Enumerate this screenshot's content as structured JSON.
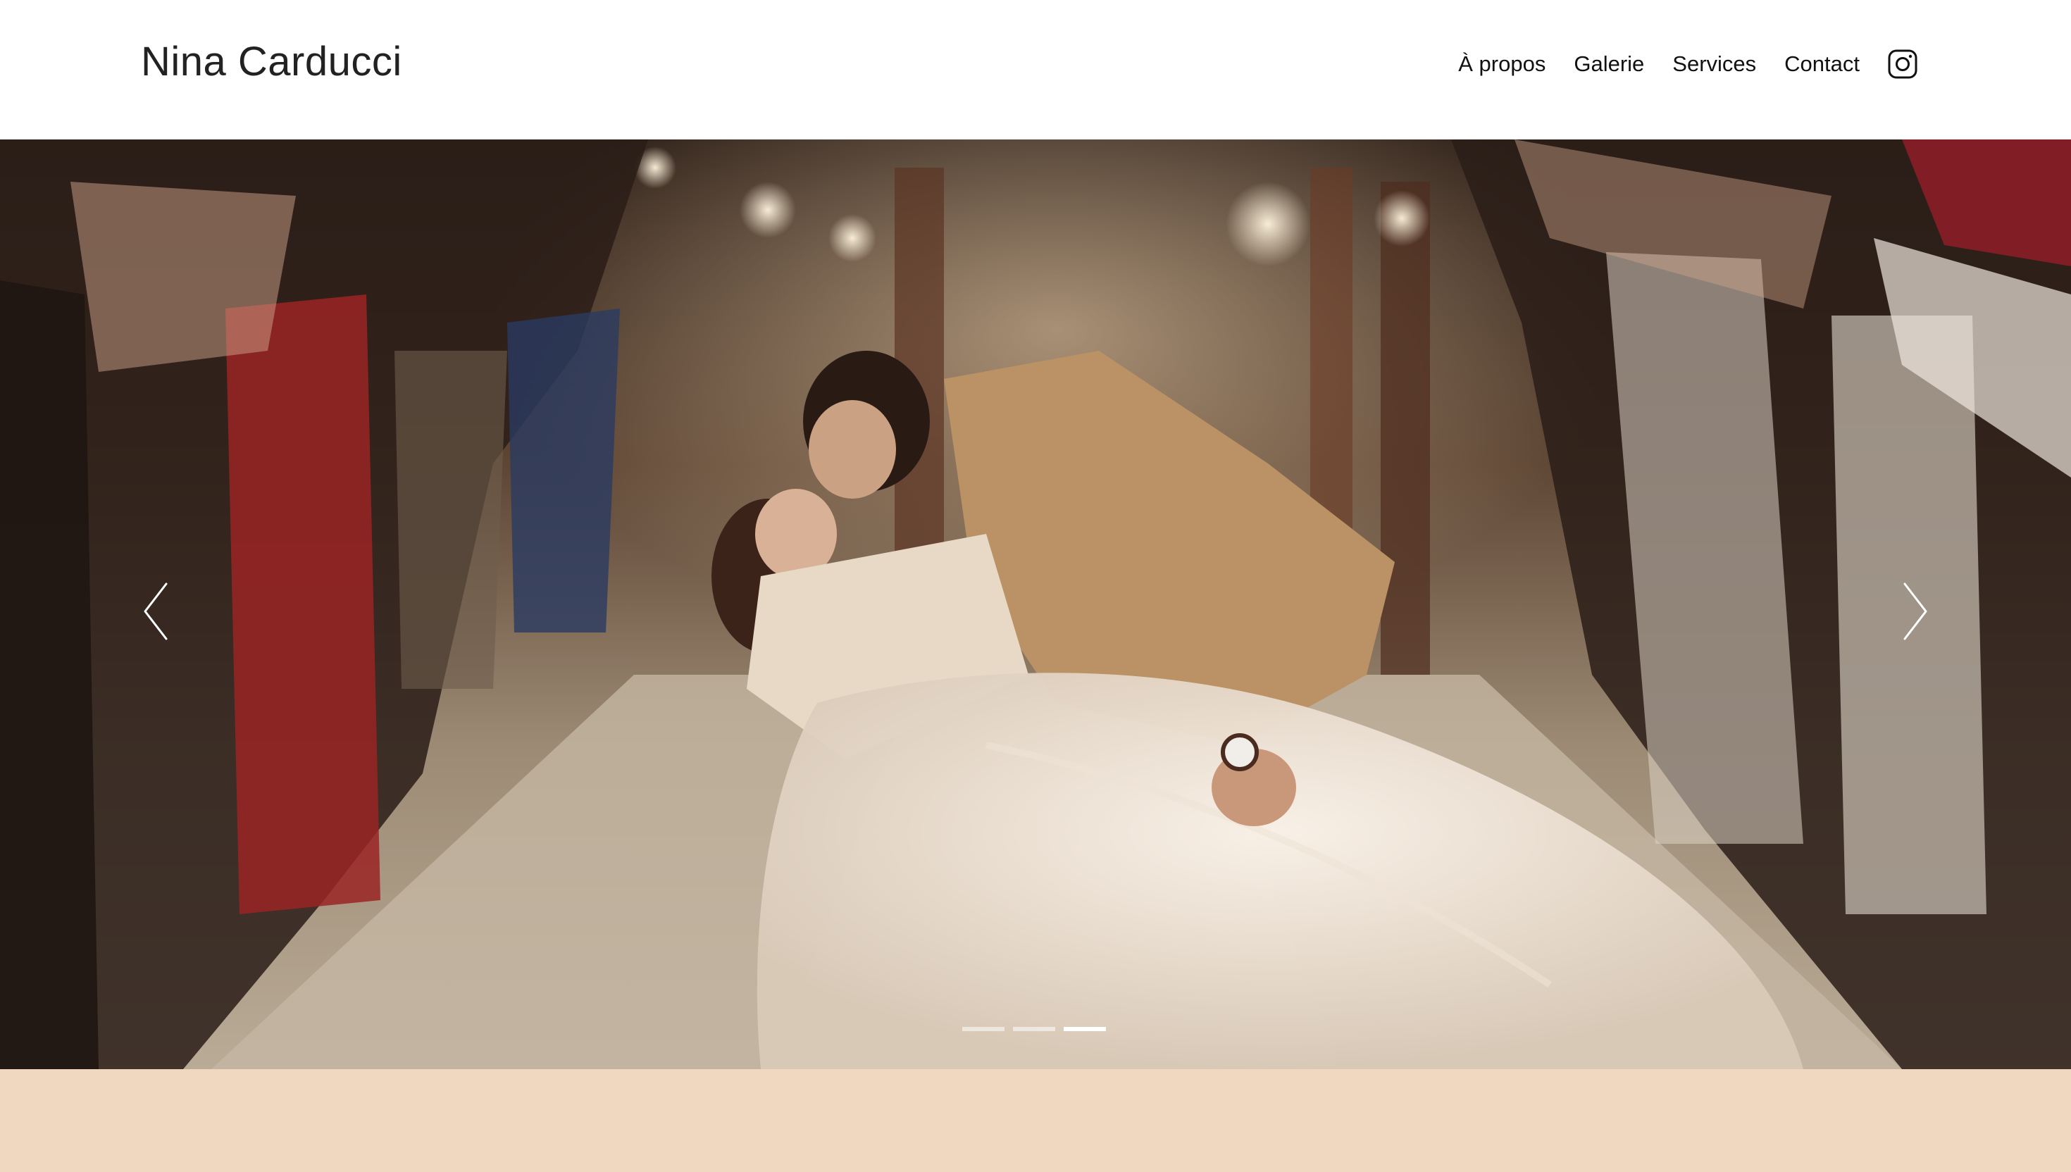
{
  "header": {
    "brand": "Nina Carducci",
    "nav": [
      {
        "label": "À propos"
      },
      {
        "label": "Galerie"
      },
      {
        "label": "Services"
      },
      {
        "label": "Contact"
      }
    ],
    "social_icon": "instagram-icon"
  },
  "carousel": {
    "image_alt": "Photo de mariage",
    "prev_icon": "chevron-left-icon",
    "next_icon": "chevron-right-icon",
    "slide_count": 3,
    "active_slide": 3
  },
  "colors": {
    "header_bg": "#ffffff",
    "text": "#1a1a1a",
    "band_bg": "#f0d8c0",
    "indicator_active": "#ffffff"
  }
}
